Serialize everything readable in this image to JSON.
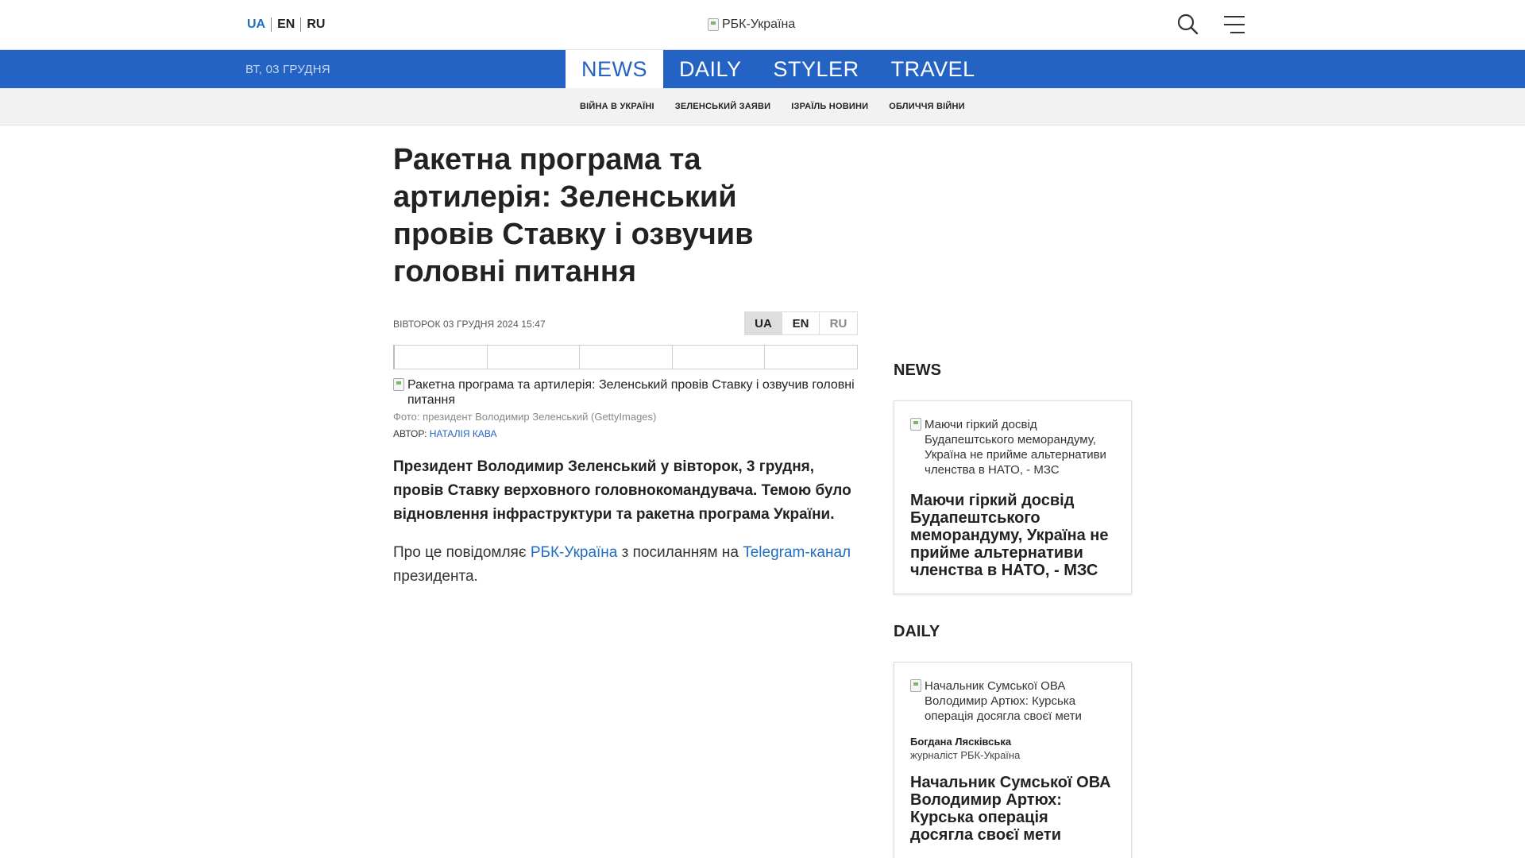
{
  "header": {
    "languages": [
      "UA",
      "EN",
      "RU"
    ],
    "active_language": "UA",
    "logo_alt": "РБК-Україна"
  },
  "nav": {
    "date": "ВТ, 03 ГРУДНЯ",
    "sections": [
      "NEWS",
      "DAILY",
      "STYLER",
      "TRAVEL"
    ],
    "active_section": "NEWS",
    "subnav": [
      "ВІЙНА В УКРАЇНІ",
      "ЗЕЛЕНСЬКИЙ ЗАЯВИ",
      "ІЗРАЇЛЬ НОВИНИ",
      "ОБЛИЧЧЯ ВІЙНИ"
    ]
  },
  "article": {
    "title": "Ракетна програма та артилерія: Зеленський провів Ставку і озвучив головні питання",
    "published": "ВІВТОРОК 03 ГРУДНЯ 2024 15:47",
    "languages": [
      "UA",
      "EN",
      "RU"
    ],
    "photo_alt": "Ракетна програма та артилерія: Зеленський провів Ставку і озвучив головні питання",
    "photo_caption": "Фото: президент Володимир Зеленський (GettyImages)",
    "author_label": "АВТОР: ",
    "author_name": "НАТАЛІЯ КАВА",
    "lead": "Президент Володимир Зеленський у вівторок, 3 грудня, провів Ставку верховного головнокомандувача. Темою було відновлення інфраструктури та ракетна програма України.",
    "body_prefix": "Про це повідомляє ",
    "body_link1": "РБК-Україна",
    "body_middle": " з посиланням на ",
    "body_link2": "Telegram-канал",
    "body_suffix": " президента."
  },
  "sidebar": {
    "news": {
      "heading": "NEWS",
      "img_alt": "Маючи гіркий досвід Будапештського меморандуму, Україна не прийме альтернативи членства в НАТО, - МЗС",
      "title": "Маючи гіркий досвід Будапештського меморандуму, Україна не прийме альтернативи членства в НАТО, - МЗС"
    },
    "daily": {
      "heading": "DAILY",
      "img_alt": "Начальник Сумської ОВА Володимир Артюх: Курська операція досягла своєї мети",
      "author": "Богдана Лясківська",
      "role": "журналіст РБК-Україна",
      "title": "Начальник Сумської ОВА Володимир Артюх: Курська операція досягла своєї мети"
    }
  },
  "colors": {
    "brand_blue": "#2463c3",
    "link_blue": "#1f6fc5"
  },
  "icons": [
    "search-icon",
    "menu-icon",
    "broken-image-icon"
  ]
}
